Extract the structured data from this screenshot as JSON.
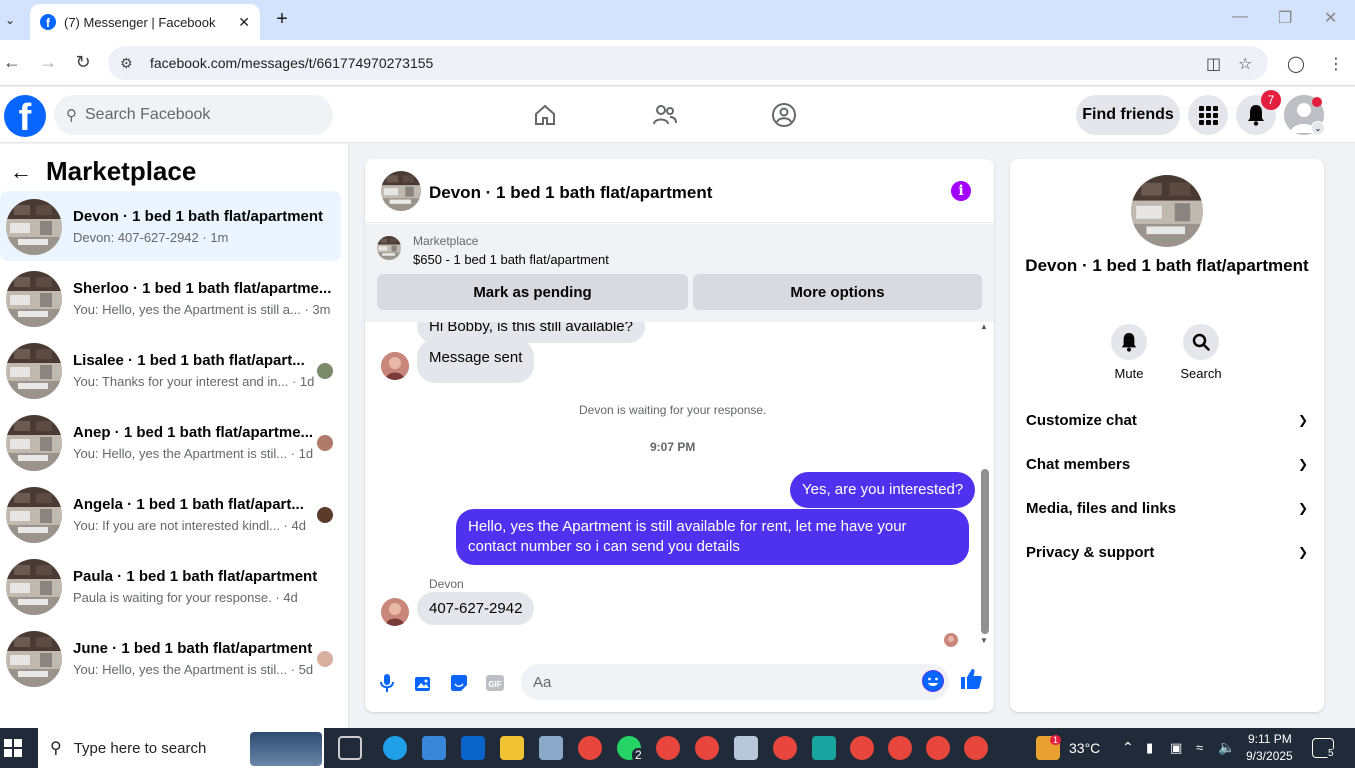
{
  "browser": {
    "tab_title": "(7) Messenger | Facebook",
    "url": "facebook.com/messages/t/661774970273155",
    "colors": {
      "chrome_bg": "#d3e3fd"
    }
  },
  "fb_header": {
    "search_placeholder": "Search Facebook",
    "find_friends_label": "Find friends",
    "notification_count": "7",
    "colors": {
      "brand": "#0866ff",
      "badge": "#e41e3f"
    }
  },
  "left_panel": {
    "title": "Marketplace",
    "conversations": [
      {
        "name": "Devon · 1 bed 1 bath flat/apartment",
        "snippet": "Devon: 407-627-2942 · 1m",
        "active": true
      },
      {
        "name": "Sherloo · 1 bed 1 bath flat/apartme...",
        "snippet": "You: Hello, yes the Apartment is still a... · 3m"
      },
      {
        "name": "Lisalee · 1 bed 1 bath flat/apart...",
        "snippet": "You: Thanks for your interest and in... · 1d"
      },
      {
        "name": "Anep · 1 bed 1 bath flat/apartme...",
        "snippet": "You: Hello, yes the Apartment is stil... · 1d"
      },
      {
        "name": "Angela · 1 bed 1 bath flat/apart...",
        "snippet": "You: If you are not interested kindl... · 4d"
      },
      {
        "name": "Paula · 1 bed 1 bath flat/apartment",
        "snippet": "Paula is waiting for your response. · 4d"
      },
      {
        "name": "June · 1 bed 1 bath flat/apartment",
        "snippet": "You: Hello, yes the Apartment is stil... · 5d"
      }
    ]
  },
  "chat": {
    "title": "Devon · 1 bed 1 bath flat/apartment",
    "marketplace_label": "Marketplace",
    "listing": "$650 - 1 bed 1 bath flat/apartment",
    "mark_pending_label": "Mark as pending",
    "more_options_label": "More options",
    "partial_message": "Hi Bobby, is this still available?",
    "message_sent": "Message sent",
    "waiting_notice": "Devon is waiting for your response.",
    "timestamp": "9:07 PM",
    "out_message_1": "Yes, are you interested?",
    "out_message_2": "Hello, yes the Apartment is still available for rent, let me have your contact number so i can send you details",
    "sender_label": "Devon",
    "in_message": "407-627-2942",
    "composer_placeholder": "Aa",
    "colors": {
      "outgoing_bubble": "#4f32f0",
      "incoming_bubble": "#e4e6eb",
      "info_icon": "#a100ff"
    }
  },
  "right_panel": {
    "name": "Devon · 1 bed 1 bath flat/apartment",
    "mute_label": "Mute",
    "search_label": "Search",
    "sections": [
      "Customize chat",
      "Chat members",
      "Media, files and links",
      "Privacy & support"
    ]
  },
  "taskbar": {
    "search_placeholder": "Type here to search",
    "temperature": "33°C",
    "time": "9:11 PM",
    "date": "9/3/2025",
    "weather_badge": "1",
    "whatsapp_badge": "2",
    "notification_count": "5"
  }
}
